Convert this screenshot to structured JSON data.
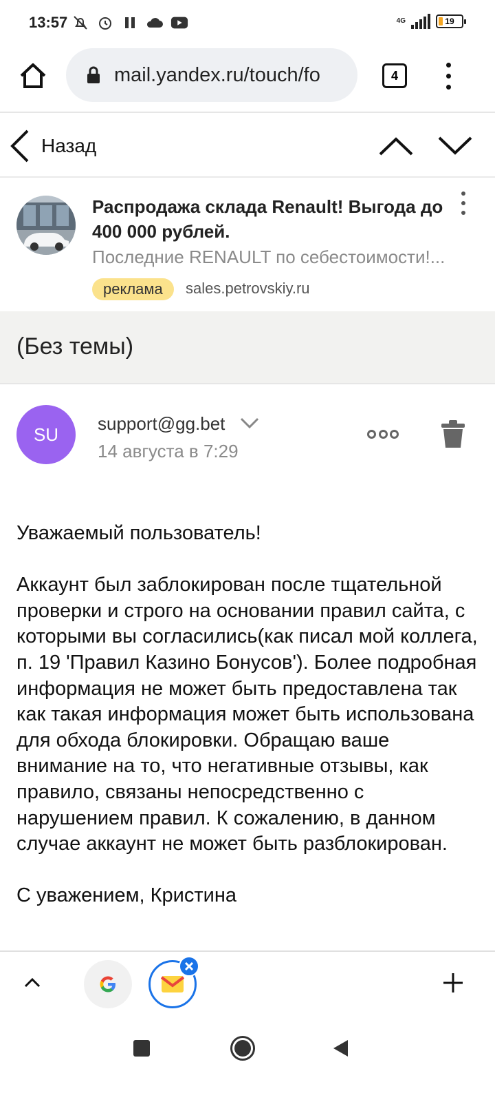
{
  "status_bar": {
    "time": "13:57",
    "network": "4G",
    "battery": "19",
    "battery_level_pct": 19,
    "icons": [
      "mute-icon",
      "alarm-icon",
      "pause-icon",
      "cloud-icon",
      "youtube-icon",
      "signal-icon",
      "battery-icon"
    ]
  },
  "browser": {
    "url": "mail.yandex.ru/touch/fo",
    "tab_count": "4"
  },
  "nav": {
    "back_label": "Назад"
  },
  "ad": {
    "title": "Распродажа склада Renault! Выгода до 400 000 рублей.",
    "subtitle": "Последние RENAULT по себестоимости!...",
    "badge": "реклама",
    "domain": "sales.petrovskiy.ru"
  },
  "email": {
    "subject": "(Без темы)",
    "avatar_initials": "SU",
    "avatar_color": "#9a63f0",
    "sender": "support@gg.bet",
    "date": "14 августа в 7:29",
    "body": [
      "Уважаемый пользователь!",
      "Аккаунт был заблокирован после тщательной проверки и строго на основании правил сайта, с которыми вы согласились(как писал мой коллега, п. 19 'Правил Казино Бонусов'). Более подробная информация не может быть предоставлена так как такая информация может быть использована для обхода блокировки. Обращаю ваше внимание на то, что негативные отзывы, как правило, связаны непосредственно с нарушением правил. К сожалению, в данном случае аккаунт не может быть разблокирован.",
      "С уважением, Кристина"
    ]
  },
  "colors": {
    "ad_badge": "#fbe28c",
    "accent": "#1a73e8",
    "subject_bg": "#f2f2f0"
  }
}
